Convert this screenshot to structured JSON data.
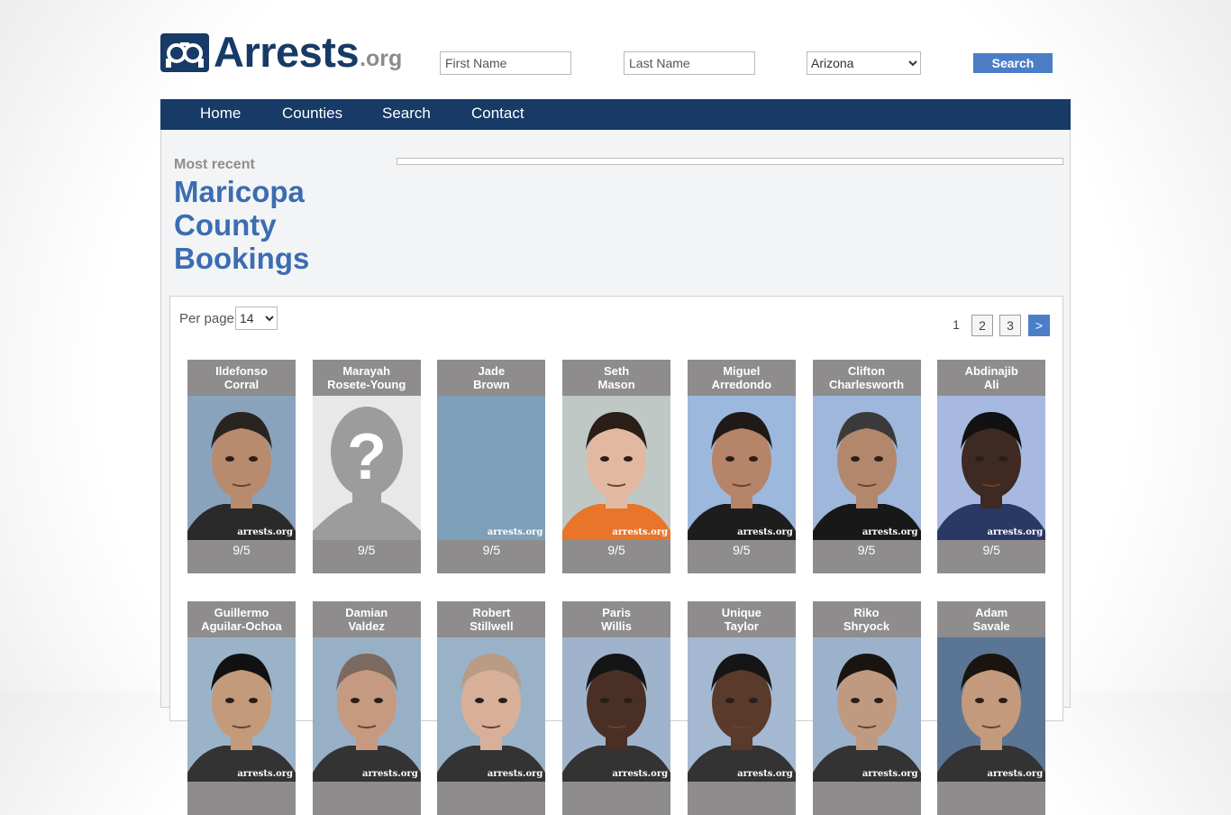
{
  "logo": {
    "name": "Arrests",
    "ext": ".org"
  },
  "search": {
    "first_placeholder": "First Name",
    "last_placeholder": "Last Name",
    "state_selected": "Arizona",
    "button_label": "Search"
  },
  "nav": [
    "Home",
    "Counties",
    "Search",
    "Contact"
  ],
  "heading": {
    "kicker": "Most recent",
    "title": "Maricopa County Bookings"
  },
  "perpage": {
    "label": "Per page",
    "value": "14"
  },
  "pagination": {
    "current": "1",
    "pages": [
      "2",
      "3"
    ],
    "next": ">"
  },
  "watermark": "arrests.org",
  "bookings": [
    {
      "first": "Ildefonso",
      "last": "Corral",
      "date": "9/5",
      "bg": "#8aa3bd",
      "skin": "#b88b6e",
      "hair": "#2a2420",
      "shirt": "#2a2a2a"
    },
    {
      "first": "Marayah",
      "last": "Rosete-Young",
      "date": "9/5",
      "placeholder": true
    },
    {
      "first": "Jade",
      "last": "Brown",
      "date": "9/5",
      "blank": true,
      "bg": "#7d9fb7"
    },
    {
      "first": "Seth",
      "last": "Mason",
      "date": "9/5",
      "bg": "#bfc8c4",
      "skin": "#e2b9a0",
      "hair": "#2b1d17",
      "shirt": "#e8752a"
    },
    {
      "first": "Miguel",
      "last": "Arredondo",
      "date": "9/5",
      "bg": "#9db8dd",
      "skin": "#b68468",
      "hair": "#1f1a18",
      "shirt": "#1d1d1d"
    },
    {
      "first": "Clifton",
      "last": "Charlesworth",
      "date": "9/5",
      "bg": "#9fb7da",
      "skin": "#b2876c",
      "hair": "#3a3a3a",
      "shirt": "#181818"
    },
    {
      "first": "Abdinajib",
      "last": "Ali",
      "date": "9/5",
      "bg": "#a7b9e0",
      "skin": "#3e2a22",
      "hair": "#111111",
      "shirt": "#2a3866"
    },
    {
      "first": "Guillermo",
      "last": "Aguilar-Ochoa",
      "date": "",
      "bg": "#9bb3c8",
      "skin": "#c39a7a",
      "hair": "#111111",
      "shirt": "#333333"
    },
    {
      "first": "Damian",
      "last": "Valdez",
      "date": "",
      "bg": "#98b0c6",
      "skin": "#c69a80",
      "hair": "#7a6a60",
      "shirt": "#333333"
    },
    {
      "first": "Robert",
      "last": "Stillwell",
      "date": "",
      "bg": "#9ab2c7",
      "skin": "#d8b09a",
      "hair": "#b89c86",
      "shirt": "#333333"
    },
    {
      "first": "Paris",
      "last": "Willis",
      "date": "",
      "bg": "#9fb4cc",
      "skin": "#4a3024",
      "hair": "#151515",
      "shirt": "#333333"
    },
    {
      "first": "Unique",
      "last": "Taylor",
      "date": "",
      "bg": "#a4b8d2",
      "skin": "#5a3a2a",
      "hair": "#151515",
      "shirt": "#333333"
    },
    {
      "first": "Riko",
      "last": "Shryock",
      "date": "",
      "bg": "#9cb2cc",
      "skin": "#c09a80",
      "hair": "#1a1410",
      "shirt": "#333333"
    },
    {
      "first": "Adam",
      "last": "Savale",
      "date": "",
      "bg": "#5b7694",
      "skin": "#c49a7c",
      "hair": "#1a1410",
      "shirt": "#333333"
    }
  ]
}
